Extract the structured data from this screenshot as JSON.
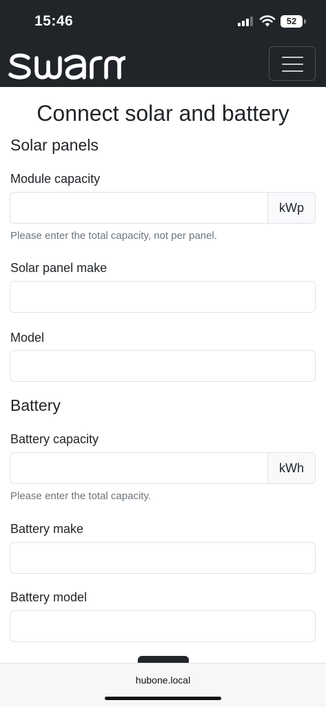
{
  "status_bar": {
    "time": "15:46",
    "battery_level": "52"
  },
  "navbar": {
    "brand": "swarm",
    "menu_icon": "hamburger-menu-icon"
  },
  "page": {
    "title": "Connect solar and battery",
    "solar": {
      "heading": "Solar panels",
      "module_capacity": {
        "label": "Module capacity",
        "value": "",
        "unit": "kWp",
        "help": "Please enter the total capacity, not per panel."
      },
      "panel_make": {
        "label": "Solar panel make",
        "value": ""
      },
      "model": {
        "label": "Model",
        "value": ""
      }
    },
    "battery": {
      "heading": "Battery",
      "capacity": {
        "label": "Battery capacity",
        "value": "",
        "unit": "kWh",
        "help": "Please enter the total capacity."
      },
      "make": {
        "label": "Battery make",
        "value": ""
      },
      "model": {
        "label": "Battery model",
        "value": ""
      }
    }
  },
  "browser": {
    "url": "hubone.local"
  }
}
